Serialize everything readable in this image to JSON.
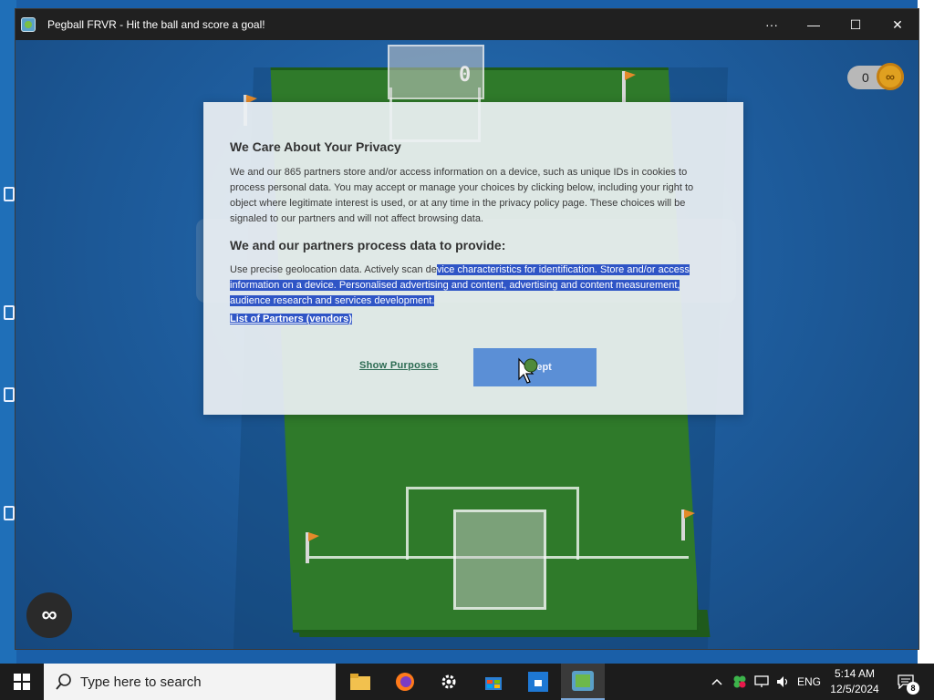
{
  "window": {
    "title": "Pegball FRVR - Hit the ball and score a goal!",
    "more_label": "···",
    "minimize_label": "—",
    "maximize_label": "☐",
    "close_label": "✕"
  },
  "game": {
    "score": "0",
    "coins": "0",
    "coin_symbol": "∞",
    "infinity_symbol": "∞"
  },
  "dialog": {
    "title": "We Care About Your Privacy",
    "body_intro": "We and our 865 partners store and/or access information on a device, such as unique IDs in cookies to process personal data. You may accept or manage your choices by clicking below, including your right to object where legitimate interest is used, or at any time in the privacy policy page. These choices will be signaled to our partners and will not affect browsing data.",
    "subtitle": "We and our partners process data to provide:",
    "purposes_plain": "Use precise geolocation data. Actively scan de",
    "purposes_selected": "vice characteristics for identification. Store and/or access information on a device. Personalised advertising and content, advertising and content measurement, audience research and services development.",
    "partners_link": "List of Partners (vendors)",
    "show_purposes": "Show Purposes",
    "accept": "Accept"
  },
  "taskbar": {
    "search_placeholder": "Type here to search",
    "language": "ENG",
    "time": "5:14 AM",
    "date": "12/5/2024",
    "notification_count": "8"
  },
  "colors": {
    "highlight": "#2f55c6",
    "accept_button": "#5b8fd6",
    "pitch_green": "#2f7a2a",
    "background_blue": "#1e5d9e"
  }
}
